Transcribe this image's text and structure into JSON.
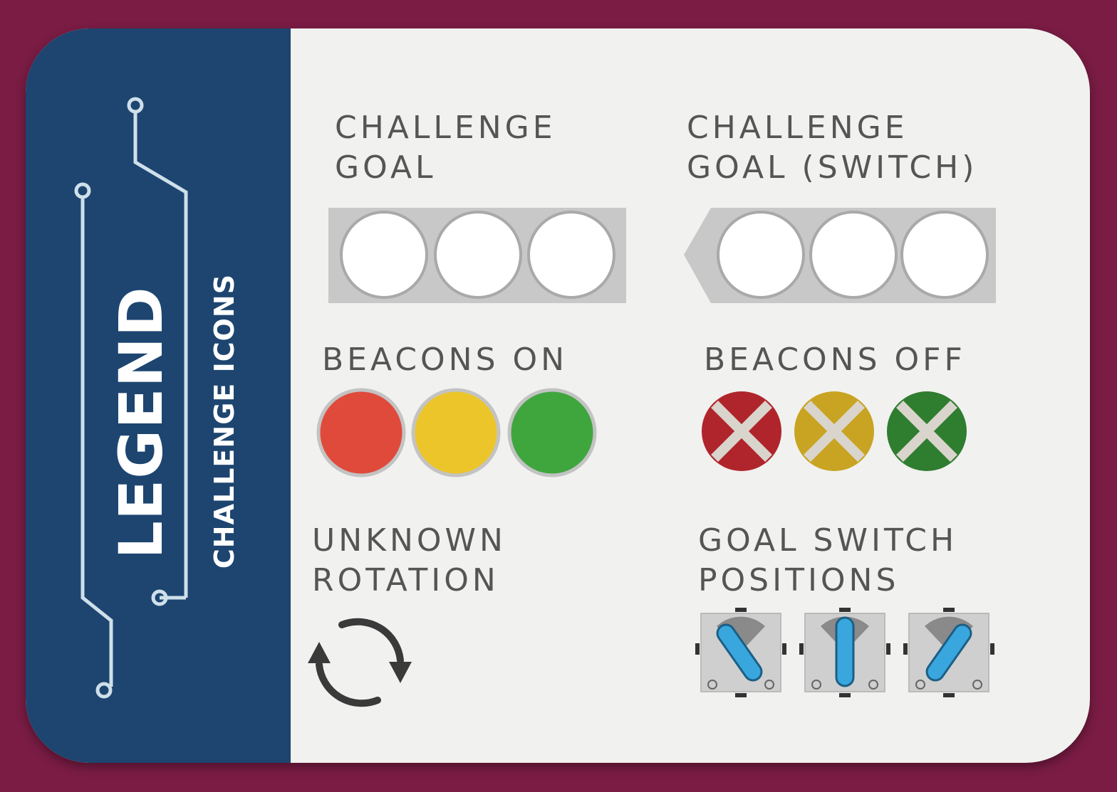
{
  "sidebar": {
    "title": "LEGEND",
    "subtitle": "CHALLENGE ICONS"
  },
  "sections": {
    "challenge_goal": {
      "line1": "CHALLENGE",
      "line2": "GOAL"
    },
    "challenge_goal_switch": {
      "line1": "CHALLENGE",
      "line2": "GOAL (SWITCH)"
    },
    "beacons_on": {
      "label": "BEACONS ON",
      "colors": [
        "#e04a3b",
        "#ecc52a",
        "#3fa63e"
      ]
    },
    "beacons_off": {
      "label": "BEACONS OFF",
      "colors": [
        "#b0252b",
        "#c9a422",
        "#2f7d2f"
      ]
    },
    "unknown_rotation": {
      "line1": "UNKNOWN",
      "line2": "ROTATION"
    },
    "goal_switch_positions": {
      "line1": "GOAL SWITCH",
      "line2": "POSITIONS"
    }
  },
  "colors": {
    "background": "#7a1c44",
    "card": "#f1f1ef",
    "sidebar": "#1d4570",
    "label_text": "#555555",
    "switch_lever": "#3aa6de"
  },
  "icons": [
    "circuit-trace",
    "rotation-arrows-icon",
    "goal-switch-icon"
  ]
}
